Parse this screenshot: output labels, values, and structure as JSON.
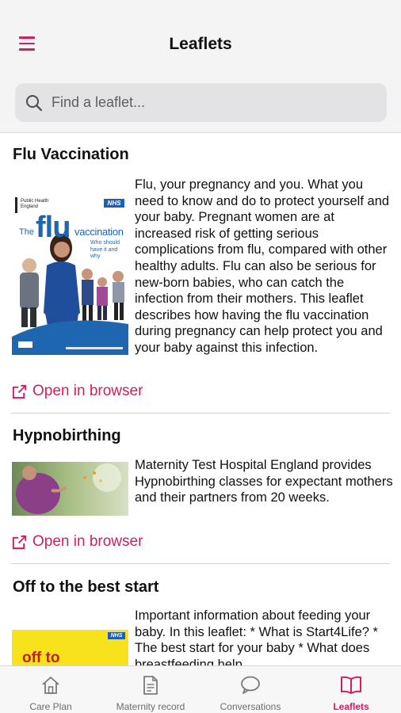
{
  "header": {
    "title": "Leaflets",
    "menu_icon": "hamburger-menu-icon"
  },
  "search": {
    "placeholder": "Find a leaflet..."
  },
  "theme": {
    "accent": "#d81b60",
    "header_bg": "#f4f4f4",
    "search_bg": "#e3e3e6"
  },
  "leaflets": [
    {
      "title": "Flu Vaccination",
      "description": "Flu, your pregnancy and you. What you need to know and do to protect yourself and your baby.  Pregnant women are at increased risk of getting serious complications from flu, compared with other healthy adults.  Flu can also be serious for new-born babies, who can catch the infection from their mothers. This leaflet describes how having the flu vaccination during pregnancy can help protect you and your baby against this infection.",
      "link_label": "Open in browser",
      "thumb": {
        "org": "Public Health England",
        "badge": "NHS",
        "the": "The",
        "flu": "flu",
        "vaccination": "vaccination",
        "subtitle": "Who should have it and why"
      }
    },
    {
      "title": "Hypnobirthing",
      "description": "Maternity Test Hospital England provides Hypnobirthing classes for expectant mothers and their partners from 20 weeks.",
      "link_label": "Open in browser"
    },
    {
      "title": "Off to the best start",
      "description": "Important information about feeding your baby.  In this leaflet: * What is Start4Life? * The best start for your baby * What does breastfeeding help",
      "thumb": {
        "badge": "NHS",
        "text": "off to"
      }
    }
  ],
  "tabs": [
    {
      "label": "Care Plan",
      "icon": "home-icon"
    },
    {
      "label": "Maternity record",
      "icon": "document-icon"
    },
    {
      "label": "Conversations",
      "icon": "chat-bubble-icon"
    },
    {
      "label": "Leaflets",
      "icon": "open-book-icon",
      "active": true
    }
  ]
}
